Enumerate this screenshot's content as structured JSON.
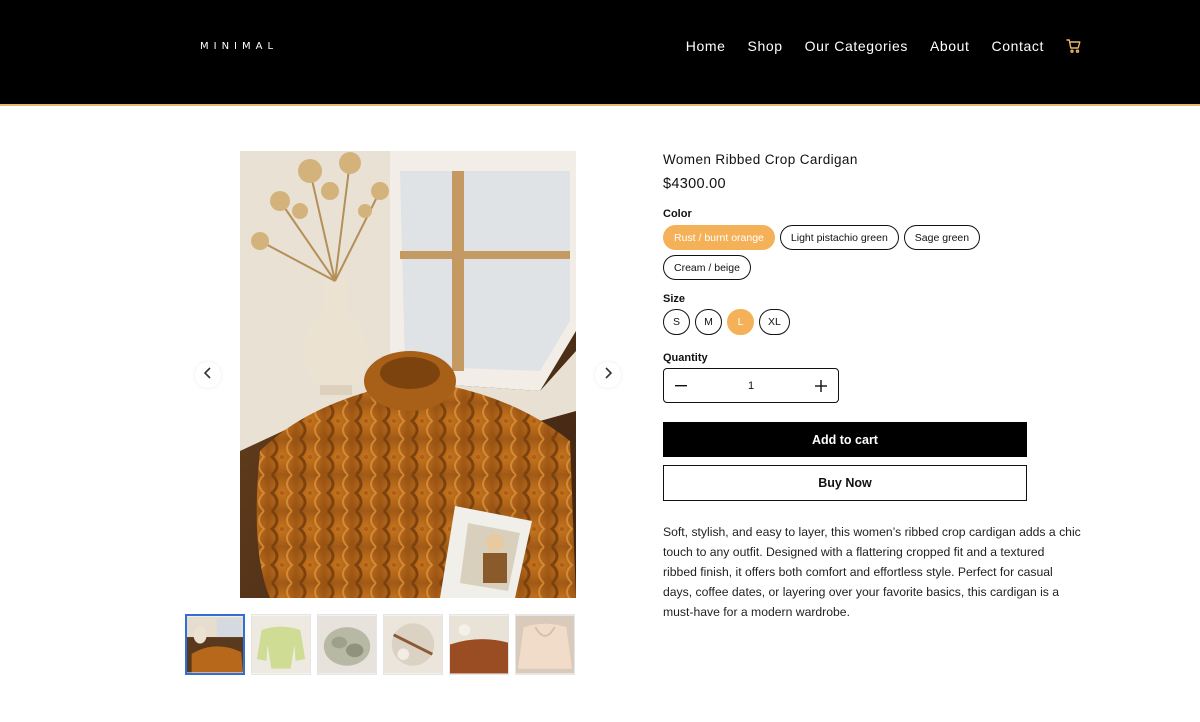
{
  "header": {
    "logo": "MINIMAL",
    "nav": [
      "Home",
      "Shop",
      "Our Categories",
      "About",
      "Contact"
    ],
    "cart_icon": "cart-icon",
    "accent": "#e8b866"
  },
  "gallery": {
    "prev_icon": "chevron-left-icon",
    "next_icon": "chevron-right-icon",
    "thumbnail_count": 6,
    "active_thumbnail": 1
  },
  "product": {
    "title": "Women Ribbed Crop Cardigan",
    "price": "$4300.00",
    "color_label": "Color",
    "colors": [
      "Rust / burnt orange",
      "Light pistachio green",
      "Sage green",
      "Cream / beige"
    ],
    "selected_color": "Rust / burnt orange",
    "size_label": "Size",
    "sizes": [
      "S",
      "M",
      "L",
      "XL"
    ],
    "selected_size": "L",
    "quantity_label": "Quantity",
    "quantity": "1",
    "add_to_cart": "Add to cart",
    "buy_now": "Buy Now",
    "description": "Soft, stylish, and easy to layer, this women’s ribbed crop cardigan adds a chic touch to any outfit. Designed with a flattering cropped fit and a textured ribbed finish, it offers both comfort and effortless style. Perfect for casual days, coffee dates, or layering over your favorite basics, this cardigan is a must-have for a modern wardrobe.",
    "selected_color_hex": "#f5b158"
  }
}
